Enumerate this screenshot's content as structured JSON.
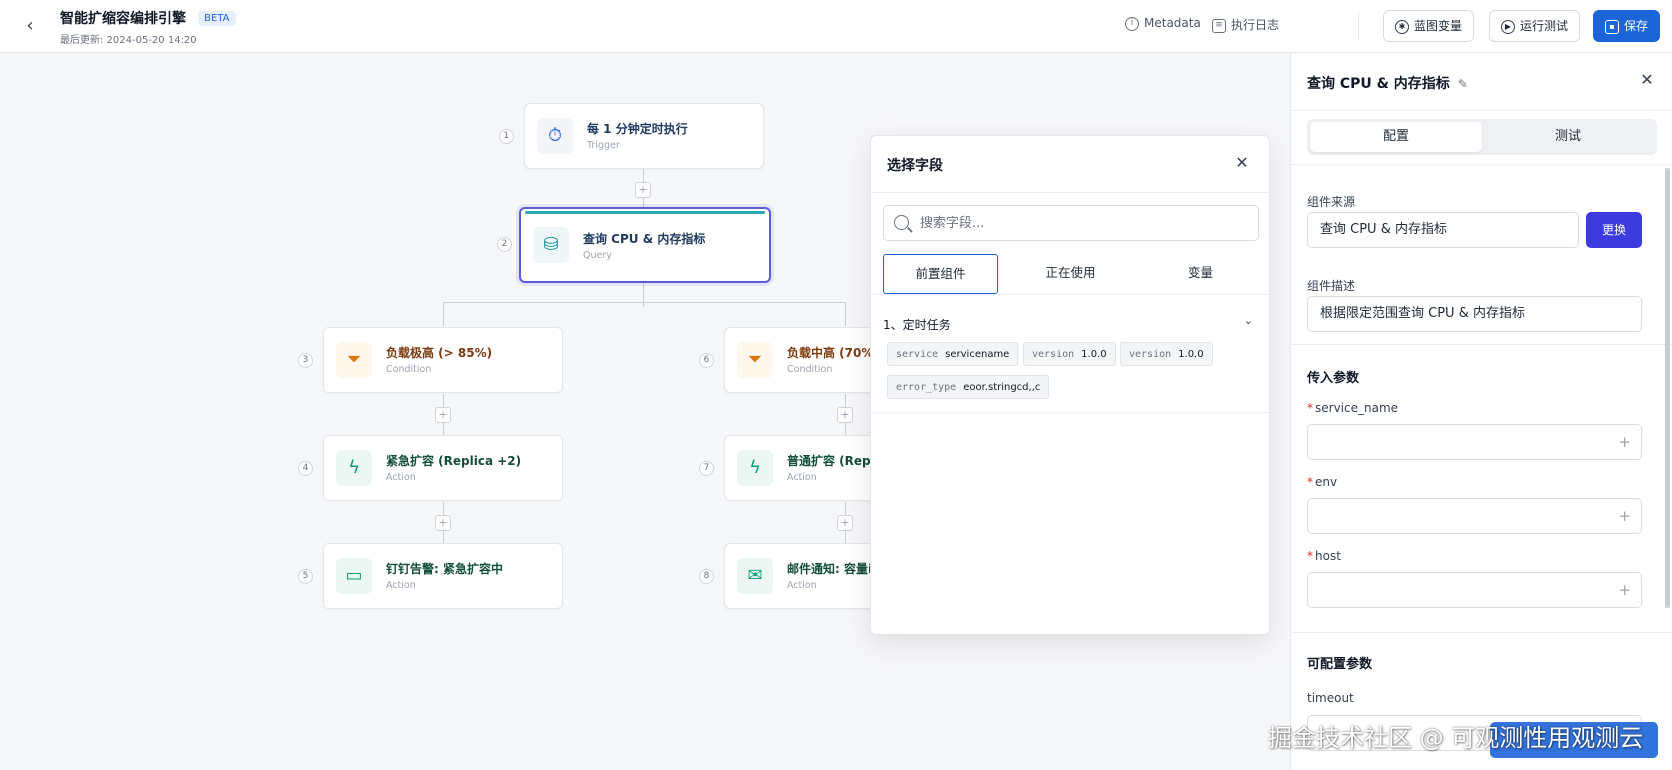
{
  "header": {
    "back_icon": "chevron-left-icon",
    "title": "智能扩缩容编排引擎",
    "badge": "BETA",
    "updated": "最后更新: 2024-05-20 14:20",
    "metadata_label": "Metadata",
    "log_label": "执行日志",
    "vars_label": "蓝图变量",
    "run_label": "运行测试",
    "save_label": "保存"
  },
  "nodes": [
    {
      "num": "1",
      "title": "每 1 分钟定时执行",
      "type": "Trigger",
      "icon": "timer-icon"
    },
    {
      "num": "2",
      "title": "查询 CPU & 内存指标",
      "type": "Query",
      "icon": "database-icon"
    },
    {
      "num": "3",
      "title": "负载极高 (> 85%)",
      "type": "Condition",
      "icon": "filter-icon"
    },
    {
      "num": "4",
      "title": "紧急扩容 (Replica +2)",
      "type": "Action",
      "icon": "bolt-icon"
    },
    {
      "num": "5",
      "title": "钉钉告警: 紧急扩容中",
      "type": "Action",
      "icon": "message-icon"
    },
    {
      "num": "6",
      "title": "负载中高 (70%",
      "type": "Condition",
      "icon": "filter-icon"
    },
    {
      "num": "7",
      "title": "普通扩容 (Repl",
      "type": "Action",
      "icon": "bolt-icon"
    },
    {
      "num": "8",
      "title": "邮件通知: 容量i",
      "type": "Action",
      "icon": "mail-icon"
    }
  ],
  "popup": {
    "title": "选择字段",
    "search_placeholder": "搜索字段...",
    "tabs": [
      "前置组件",
      "正在使用",
      "变量"
    ],
    "group": "1、定时任务",
    "chips": [
      {
        "key": "service",
        "value": "servicename"
      },
      {
        "key": "version",
        "value": "1.0.0"
      },
      {
        "key": "version",
        "value": "1.0.0"
      },
      {
        "key": "error_type",
        "value": "eoor.stringcd,,c"
      }
    ]
  },
  "panel": {
    "title": "查询 CPU & 内存指标",
    "tabs": [
      "配置",
      "测试"
    ],
    "source_label": "组件来源",
    "source_value": "查询 CPU & 内存指标",
    "swap_label": "更换",
    "desc_label": "组件描述",
    "desc_value": "根据限定范围查询 CPU & 内存指标",
    "inputs_title": "传入参数",
    "params": [
      {
        "name": "service_name",
        "value": ""
      },
      {
        "name": "env",
        "value": ""
      },
      {
        "name": "host",
        "value": ""
      }
    ],
    "config_title": "可配置参数",
    "timeout_label": "timeout",
    "required_mark": "*"
  },
  "watermark": "掘金技术社区 @ 可观测性用观测云"
}
